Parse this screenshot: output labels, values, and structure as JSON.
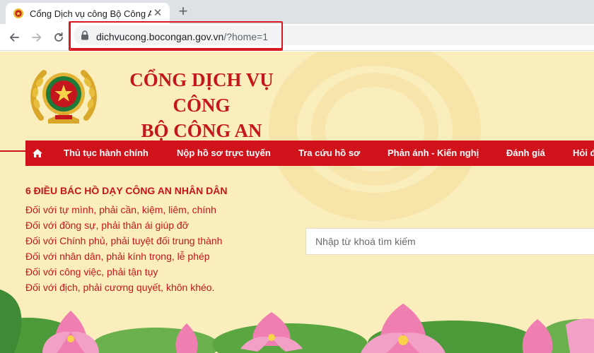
{
  "browser": {
    "tab_title": "Cổng Dịch vụ công Bộ Công An",
    "url_host": "dichvucong.bocongan.gov.vn",
    "url_path": "/?home=1"
  },
  "portal": {
    "title_line1": "CỔNG DỊCH VỤ CÔNG",
    "title_line2": "BỘ CÔNG AN"
  },
  "nav": {
    "items": [
      "Thủ tục hành chính",
      "Nộp hồ sơ trực tuyến",
      "Tra cứu hồ sơ",
      "Phản ánh - Kiến nghị",
      "Đánh giá",
      "Hỏi đ"
    ]
  },
  "teachings": {
    "heading": "6 ĐIỀU BÁC HỒ DẠY CÔNG AN NHÂN DÂN",
    "lines": [
      "Đối với tự mình, phải cần, kiệm, liêm, chính",
      "Đối với đồng sự, phải thân ái giúp đỡ",
      "Đối với Chính phủ, phải tuyệt đối trung thành",
      "Đối với nhân dân, phải kính trọng, lễ phép",
      "Đối với công việc, phải tận tụy",
      "Đối với địch, phải cương quyết, khôn khéo."
    ]
  },
  "search": {
    "placeholder": "Nhập từ khoá tìm kiếm"
  },
  "colors": {
    "brand_red": "#d0121b",
    "text_red": "#c4161c",
    "page_bg": "#fbeebd",
    "highlight_box": "#d81921"
  },
  "icons": {
    "favicon": "police-emblem-icon",
    "back": "arrow-left-icon",
    "forward": "arrow-right-icon",
    "reload": "reload-icon",
    "lock": "lock-icon",
    "home": "home-icon",
    "new_tab": "plus-icon",
    "close": "close-icon"
  }
}
